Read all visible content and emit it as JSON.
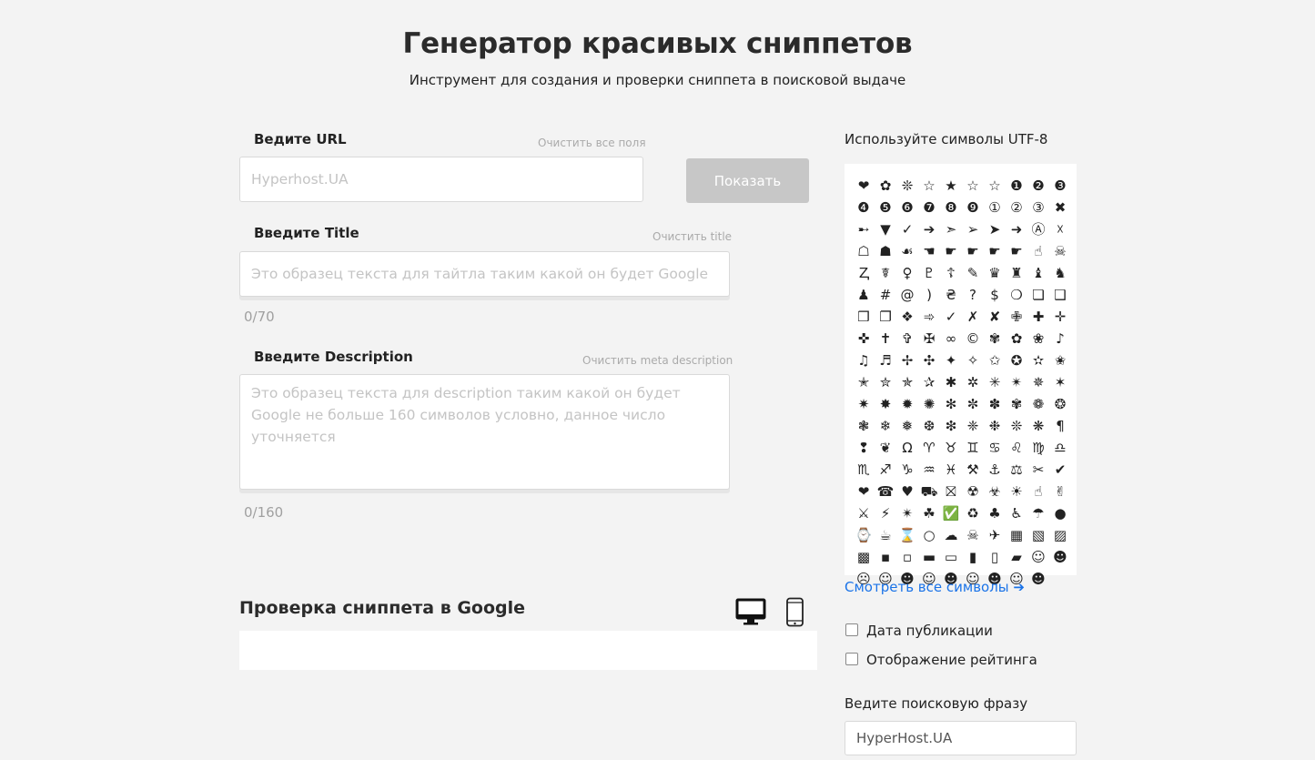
{
  "header": {
    "title": "Генератор красивых сниппетов",
    "subtitle": "Инструмент для создания и проверки сниппета в поисковой выдаче"
  },
  "url_field": {
    "label": "Ведите URL",
    "clear_all": "Очистить все поля",
    "placeholder": "Hyperhost.UA",
    "button": "Показать"
  },
  "title_field": {
    "label": "Введите Title",
    "clear": "Очистить title",
    "placeholder": "Это образец текста для тайтла таким какой он будет Google",
    "counter": "0/70"
  },
  "description_field": {
    "label": "Введите Description",
    "clear": "Очистить meta description",
    "placeholder": "Это образец текста для description таким какой он будет Google не больше 160 символов условно, данное число уточняется",
    "counter": "0/160"
  },
  "preview": {
    "heading": "Проверка сниппета в Google",
    "desktop_icon": "desktop-monitor-icon",
    "mobile_icon": "mobile-phone-icon"
  },
  "sidebar": {
    "utf_heading": "Используйте символы UTF-8",
    "symbols": [
      "❤",
      "✿",
      "❊",
      "☆",
      "★",
      "☆",
      "☆",
      "❶",
      "❷",
      "❸",
      "❹",
      "❺",
      "❻",
      "❼",
      "❽",
      "❾",
      "①",
      "②",
      "③",
      "✖",
      "➸",
      "▼",
      "✓",
      "➔",
      "➣",
      "➢",
      "➤",
      "➜",
      "Ⓐ",
      "☓",
      "☖",
      "☗",
      "☙",
      "☚",
      "☛",
      "☛",
      "☛",
      "☛",
      "☝",
      "☠",
      "Ⱬ",
      "☤",
      "♀",
      "♇",
      "☦",
      "✎",
      "♛",
      "♜",
      "♝",
      "♞",
      "♟",
      "#",
      "@",
      ")",
      "₴",
      "?",
      "$",
      "❍",
      "❏",
      "❑",
      "❒",
      "❐",
      "❖",
      "➾",
      "✓",
      "✗",
      "✘",
      "✙",
      "✚",
      "✛",
      "✜",
      "✝",
      "✞",
      "✠",
      "∞",
      "©",
      "✾",
      "✿",
      "❀",
      "♪",
      "♫",
      "♬",
      "✢",
      "✣",
      "✦",
      "✧",
      "✩",
      "✪",
      "✫",
      "✬",
      "✭",
      "✮",
      "✯",
      "✰",
      "✱",
      "✲",
      "✳",
      "✴",
      "✵",
      "✶",
      "✷",
      "✸",
      "✹",
      "✺",
      "✻",
      "✼",
      "✽",
      "✾",
      "❁",
      "❂",
      "❃",
      "❄",
      "❅",
      "❆",
      "❇",
      "❈",
      "❉",
      "❊",
      "❋",
      "¶",
      "❢",
      "❦",
      "Ω",
      "♈",
      "♉",
      "♊",
      "♋",
      "♌",
      "♍",
      "♎",
      "♏",
      "♐",
      "♑",
      "♒",
      "♓",
      "⚒",
      "⚓",
      "⚖",
      "✂",
      "✔",
      "❤",
      "☎",
      "♥",
      "⛟",
      "⛝",
      "☢",
      "☣",
      "☀",
      "☝",
      "✌",
      "⚔",
      "⚡",
      "✴",
      "☘",
      "✅",
      "♻",
      "♣",
      "♿",
      "☂",
      "●",
      "⌚",
      "☕",
      "⌛",
      "○",
      "☁",
      "☠",
      "✈",
      "▦",
      "▧",
      "▨",
      "▩",
      "▪",
      "▫",
      "▬",
      "▭",
      "▮",
      "▯",
      "▰",
      "☺",
      "☻",
      "☹",
      "☺",
      "☻",
      "☺",
      "☻",
      "☺",
      "☻",
      "☺",
      "☻"
    ],
    "see_all": "Смотреть все символы ➔",
    "checkbox_date": "Дата публикации",
    "checkbox_rating": "Отображение рейтинга",
    "search_label": "Ведите поисковую фразу",
    "search_value": "HyperHost.UA"
  }
}
